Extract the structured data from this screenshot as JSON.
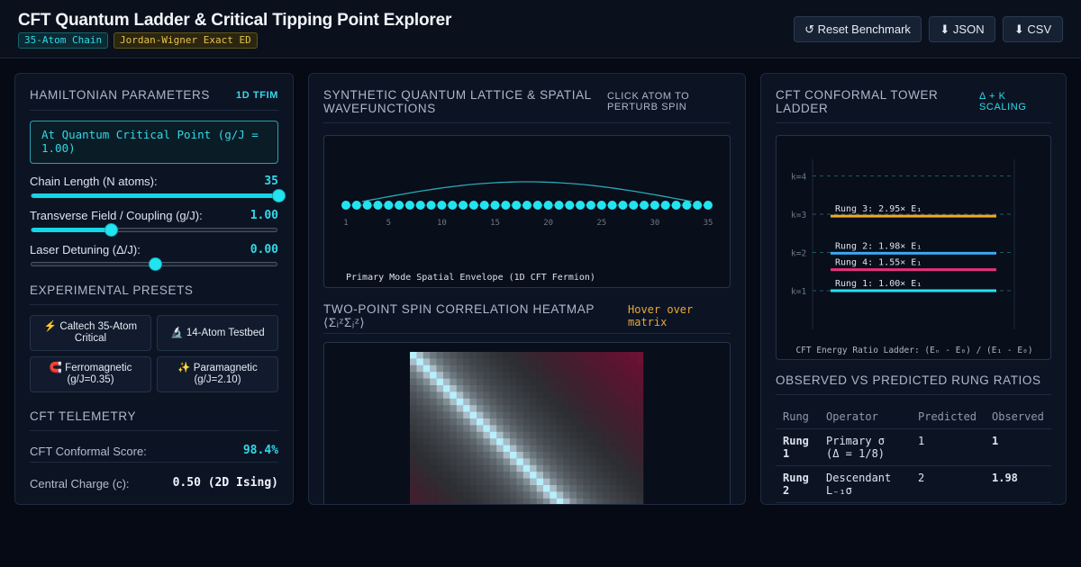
{
  "header": {
    "title": "CFT Quantum Ladder & Critical Tipping Point Explorer",
    "badges": [
      "35-Atom Chain",
      "Jordan-Wigner Exact ED"
    ],
    "buttons": {
      "reset": "↺ Reset Benchmark",
      "json": "⬇ JSON",
      "csv": "⬇ CSV"
    }
  },
  "hamiltonian": {
    "title": "Hamiltonian Parameters",
    "tag": "1D TFIM",
    "status": "At Quantum Critical Point (g/J = 1.00)",
    "sliders": [
      {
        "label": "Chain Length (N atoms):",
        "value": "35",
        "fraction": 1.0
      },
      {
        "label": "Transverse Field / Coupling (g/J):",
        "value": "1.00",
        "fraction": 0.32
      },
      {
        "label": "Laser Detuning (Δ/J):",
        "value": "0.00",
        "fraction": 0.5
      }
    ]
  },
  "presets": {
    "title": "Experimental Presets",
    "items": [
      "⚡ Caltech 35-Atom Critical",
      "🔬 14-Atom Testbed",
      "🧲 Ferromagnetic (g/J=0.35)",
      "✨ Paramagnetic (g/J=2.10)"
    ]
  },
  "telemetry": {
    "title": "CFT Telemetry",
    "rows": [
      {
        "label": "CFT Conformal Score:",
        "value": "98.4%",
        "color": "#33d9e8"
      },
      {
        "label": "Central Charge (c):",
        "value": "0.50 (2D Ising)",
        "color": "#f2f5fa"
      }
    ]
  },
  "lattice": {
    "title": "Synthetic Quantum Lattice & Spatial Wavefunctions",
    "hint": "Click atom to perturb spin",
    "atom_count": 35,
    "tick_labels": [
      "1",
      "5",
      "10",
      "15",
      "20",
      "25",
      "30",
      "35"
    ],
    "caption": "Primary Mode Spatial Envelope (1D CFT Fermion)",
    "colors": {
      "atom": "#22e4f0",
      "envelope": "#2aa8b4"
    }
  },
  "heatmap": {
    "title": "Two-Point Spin Correlation Heatmap ⟨ΣᵢᶻΣⱼᶻ⟩",
    "hint": "Hover over matrix",
    "size": 35
  },
  "tower": {
    "title": "CFT Conformal Tower Ladder",
    "tag": "Δ + k Scaling",
    "k_labels": [
      "k=4",
      "k=3",
      "k=2",
      "k=1"
    ],
    "rungs": [
      {
        "label": "Rung 3: 2.95× E₁",
        "ratio": 2.95,
        "color": "#f5a623"
      },
      {
        "label": "Rung 2: 1.98× E₁",
        "ratio": 1.98,
        "color": "#3aa8f0"
      },
      {
        "label": "Rung 4: 1.55× E₁",
        "ratio": 1.55,
        "color": "#e8307a"
      },
      {
        "label": "Rung 1: 1.00× E₁",
        "ratio": 1.0,
        "color": "#22e4f0"
      }
    ],
    "caption": "CFT Energy Ratio Ladder: (Eₙ - E₀) / (E₁ - E₀)"
  },
  "ratios": {
    "title": "Observed vs Predicted Rung Ratios",
    "headers": [
      "Rung",
      "Operator",
      "Predicted",
      "Observed"
    ],
    "rows": [
      {
        "rung": "Rung 1",
        "operator": "Primary σ (Δ = 1/8)",
        "predicted": "1",
        "observed": "1"
      },
      {
        "rung": "Rung 2",
        "operator": "Descendant L₋₁σ",
        "predicted": "2",
        "observed": "1.98"
      }
    ]
  }
}
